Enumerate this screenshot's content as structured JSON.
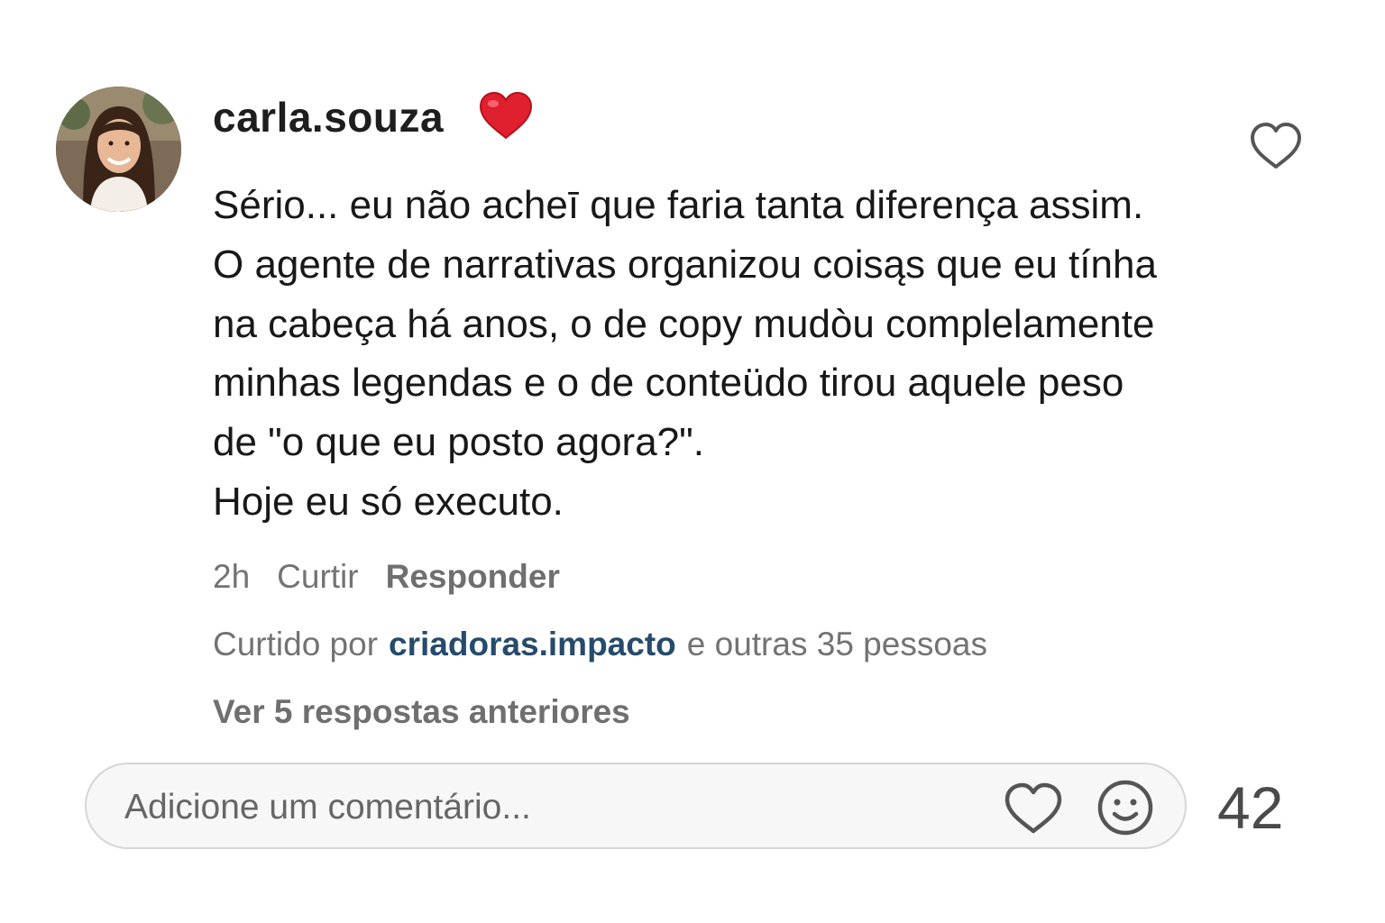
{
  "comment": {
    "username": "carla.souza",
    "lines": [
      "Sério... eu não acheī que faria tanta diferença assim.",
      "O agente de narrativas organizou coisąs que eu tínha",
      "na cabeça há anos, o de copy mudòu complelamente",
      "minhas legendas e o de conteüdo tirou aquele peso",
      "de \"o que eu posto agora?\".",
      "Hoje eu só executo."
    ],
    "time": "2h",
    "like_label": "Curtir",
    "reply_label": "Responder",
    "liked_by": {
      "prefix": "Curtido por",
      "user": "criadoras.impacto",
      "suffix": "e outras 35 pessoas"
    },
    "view_replies": "Ver 5 respostas anteriores"
  },
  "composer": {
    "placeholder": "Adicione um comentário...",
    "count": "42"
  },
  "icons": {
    "badge": "red-heart-emoji-icon",
    "comment_like": "heart-outline-icon",
    "composer_like": "heart-outline-icon",
    "emoji": "smiley-icon"
  },
  "colors": {
    "link": "#264b6b",
    "muted": "#737373",
    "badge_heart": "#e0202e"
  }
}
